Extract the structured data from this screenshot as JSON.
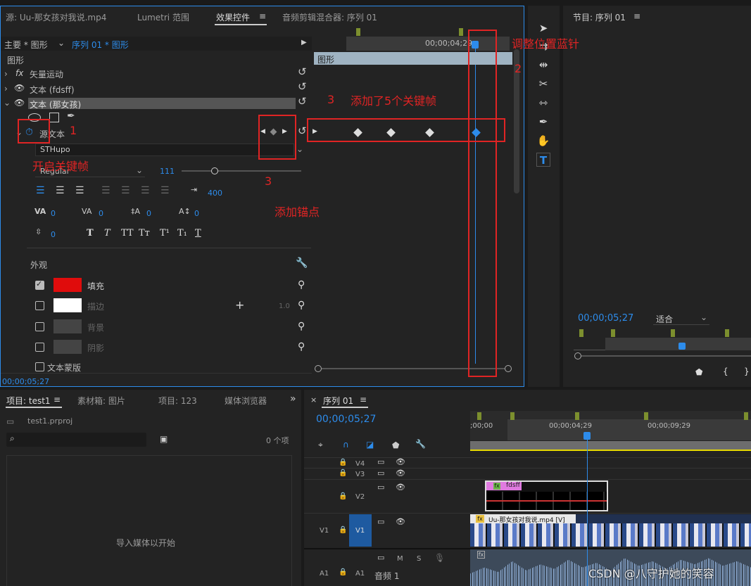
{
  "tabs": {
    "source": "源: Uu-那女孩对我说.mp4",
    "lumetri": "Lumetri 范围",
    "effect_controls": "效果控件",
    "menu": "≡",
    "audio_mixer": "音频剪辑混合器: 序列 01"
  },
  "ec": {
    "master": "主要 * 图形",
    "clip": "序列 01 * 图形",
    "timecode_ruler": "00;00;04;29",
    "clip_bar": "图形",
    "section": "图形",
    "fx_motion": "矢量运动",
    "fx_motion_prefix": "fx",
    "text1": "文本 (fdsff)",
    "text2": "文本 (那女孩)",
    "source_text": "源文本",
    "font": "STHupo",
    "style": "Regular",
    "font_size": "111",
    "tracking": "400",
    "va": "0",
    "va2": "0",
    "leading": "0",
    "baseline": "0",
    "tsume": "0",
    "appearance": "外观",
    "fill": "填充",
    "stroke": "描边",
    "stroke_width": "1.0",
    "background": "背景",
    "shadow": "阴影",
    "text_mask": "文本蒙版",
    "timecode": "00;00;05;27",
    "fill_color": "#e00c0c",
    "stroke_color": "#ffffff"
  },
  "annotations": {
    "open_kf": "开启关键帧",
    "one": "1",
    "two": "2",
    "three_a": "3",
    "three_b": "3",
    "move_needle": "调整位置蓝针",
    "added_kf": "添加了5个关键帧",
    "add_anchor": "添加锚点"
  },
  "program": {
    "title": "节目: 序列 01",
    "menu": "≡",
    "timecode": "00;00;05;27",
    "fit": "适合"
  },
  "project": {
    "tab": "项目: test1",
    "bin": "素材箱: 图片",
    "proj2": "项目: 123",
    "media_browser": "媒体浏览器",
    "file": "test1.prproj",
    "count": "0 个项",
    "import_hint": "导入媒体以开始"
  },
  "sequence": {
    "tab": "序列 01",
    "timecode": "00;00;05;27",
    "t0": ";00;00",
    "t1": "00;00;04;29",
    "t2": "00;00;09;29",
    "v4": "V4",
    "v3": "V3",
    "v2": "V2",
    "v1": "V1",
    "v1b": "V1",
    "a1": "A1",
    "a1b": "A1",
    "audio": "音频 1",
    "m": "M",
    "s": "S",
    "clip_text": "fdsff",
    "clip_video": "Uu-那女孩对我说.mp4 [V]",
    "fx": "fx"
  },
  "watermark": "CSDN @八守护她的笑容"
}
